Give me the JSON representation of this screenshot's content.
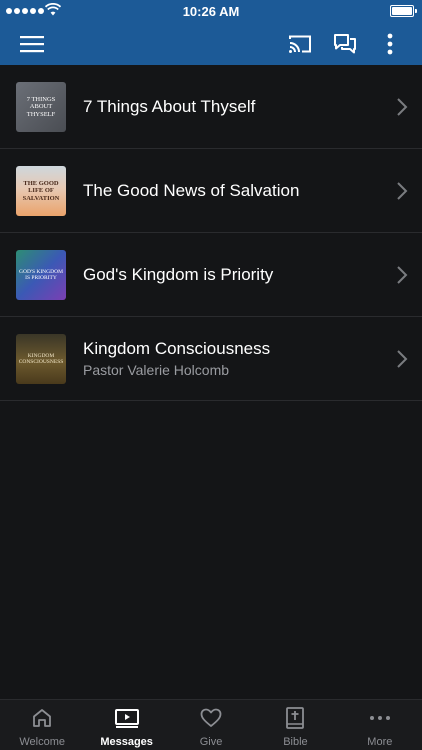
{
  "status_bar": {
    "time": "10:26 AM"
  },
  "nav": {
    "menu_icon": "hamburger-icon",
    "cast_icon": "cast-icon",
    "chat_icon": "chat-icon",
    "more_icon": "vertical-ellipsis-icon"
  },
  "messages": [
    {
      "title": "7 Things About Thyself",
      "subtitle": "",
      "thumb_text": "7 Things About Thyself"
    },
    {
      "title": "The Good News of Salvation",
      "subtitle": "",
      "thumb_text": "The Good Life of Salvation"
    },
    {
      "title": "God's Kingdom is Priority",
      "subtitle": "",
      "thumb_text": "God's Kingdom is Priority"
    },
    {
      "title": "Kingdom Consciousness",
      "subtitle": "Pastor Valerie Holcomb",
      "thumb_text": "Kingdom Consciousness"
    }
  ],
  "tabs": [
    {
      "label": "Welcome",
      "icon": "home-icon",
      "active": false
    },
    {
      "label": "Messages",
      "icon": "video-play-icon",
      "active": true
    },
    {
      "label": "Give",
      "icon": "heart-icon",
      "active": false
    },
    {
      "label": "Bible",
      "icon": "bible-icon",
      "active": false
    },
    {
      "label": "More",
      "icon": "horizontal-ellipsis-icon",
      "active": false
    }
  ],
  "colors": {
    "header": "#1c5a97",
    "background": "#141517",
    "tab_inactive": "#8c8e93",
    "tab_active": "#ffffff"
  }
}
